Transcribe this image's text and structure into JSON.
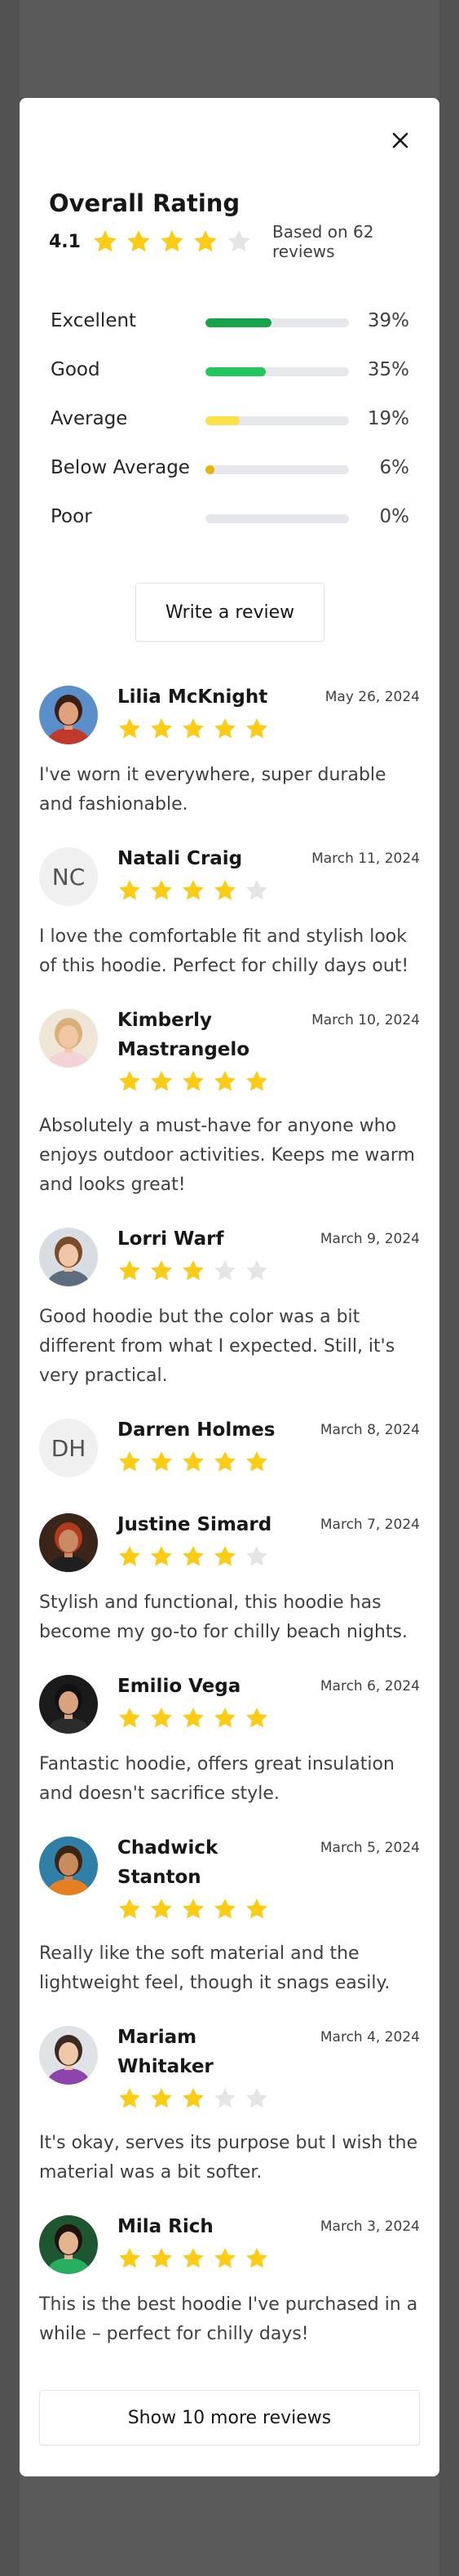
{
  "colors": {
    "star_filled": "#facc15",
    "star_empty": "#e5e5e5",
    "bar_excellent": "#16a34a",
    "bar_good": "#22c55e",
    "bar_average": "#fde047",
    "bar_below_average": "#eab308",
    "bar_poor": "#ef4444"
  },
  "modal": {
    "close_icon": "close-icon",
    "title": "Overall Rating",
    "rating_value": "4.1",
    "rating_stars": 4,
    "based_on": "Based on 62 reviews"
  },
  "breakdown": [
    {
      "label": "Excellent",
      "percent": "39%",
      "fill": 0.46,
      "color": "#16a34a"
    },
    {
      "label": "Good",
      "percent": "35%",
      "fill": 0.42,
      "color": "#22c55e"
    },
    {
      "label": "Average",
      "percent": "19%",
      "fill": 0.24,
      "color": "#fde047"
    },
    {
      "label": "Below Average",
      "percent": "6%",
      "fill": 0.06,
      "color": "#eab308"
    },
    {
      "label": "Poor",
      "percent": "0%",
      "fill": 0.0,
      "color": "#ef4444"
    }
  ],
  "write_review_label": "Write a review",
  "reviews": [
    {
      "name": "Lilia McKnight",
      "date": "May 26, 2024",
      "stars": 5,
      "avatar": "photo",
      "initials": "",
      "text": "I've worn it everywhere, super durable and fashionable."
    },
    {
      "name": "Natali Craig",
      "date": "March 11, 2024",
      "stars": 4,
      "avatar": "initials",
      "initials": "NC",
      "text": "I love the comfortable fit and stylish look of this hoodie. Perfect for chilly days out!"
    },
    {
      "name": "Kimberly Mastrangelo",
      "date": "March 10, 2024",
      "stars": 5,
      "avatar": "photo",
      "initials": "",
      "text": "Absolutely a must-have for anyone who enjoys outdoor activities. Keeps me warm and looks great!"
    },
    {
      "name": "Lorri Warf",
      "date": "March 9, 2024",
      "stars": 3,
      "avatar": "photo",
      "initials": "",
      "text": "Good hoodie but the color was a bit different from what I expected. Still, it's very practical."
    },
    {
      "name": "Darren Holmes",
      "date": "March 8, 2024",
      "stars": 5,
      "avatar": "initials",
      "initials": "DH",
      "text": ""
    },
    {
      "name": "Justine Simard",
      "date": "March 7, 2024",
      "stars": 4,
      "avatar": "photo",
      "initials": "",
      "text": "Stylish and functional, this hoodie has become my go-to for chilly beach nights."
    },
    {
      "name": "Emilio Vega",
      "date": "March 6, 2024",
      "stars": 5,
      "avatar": "photo",
      "initials": "",
      "text": "Fantastic hoodie, offers great insulation and doesn't sacrifice style."
    },
    {
      "name": "Chadwick Stanton",
      "date": "March 5, 2024",
      "stars": 5,
      "avatar": "photo",
      "initials": "",
      "text": "Really like the soft material and the lightweight feel, though it snags easily."
    },
    {
      "name": "Mariam Whitaker",
      "date": "March 4, 2024",
      "stars": 3,
      "avatar": "photo",
      "initials": "",
      "text": "It's okay, serves its purpose but I wish the material was a bit softer."
    },
    {
      "name": "Mila Rich",
      "date": "March 3, 2024",
      "stars": 5,
      "avatar": "photo",
      "initials": "",
      "text": "This is the best hoodie I've purchased in a while – perfect for chilly days!"
    }
  ],
  "show_more_label": "Show 10 more reviews"
}
